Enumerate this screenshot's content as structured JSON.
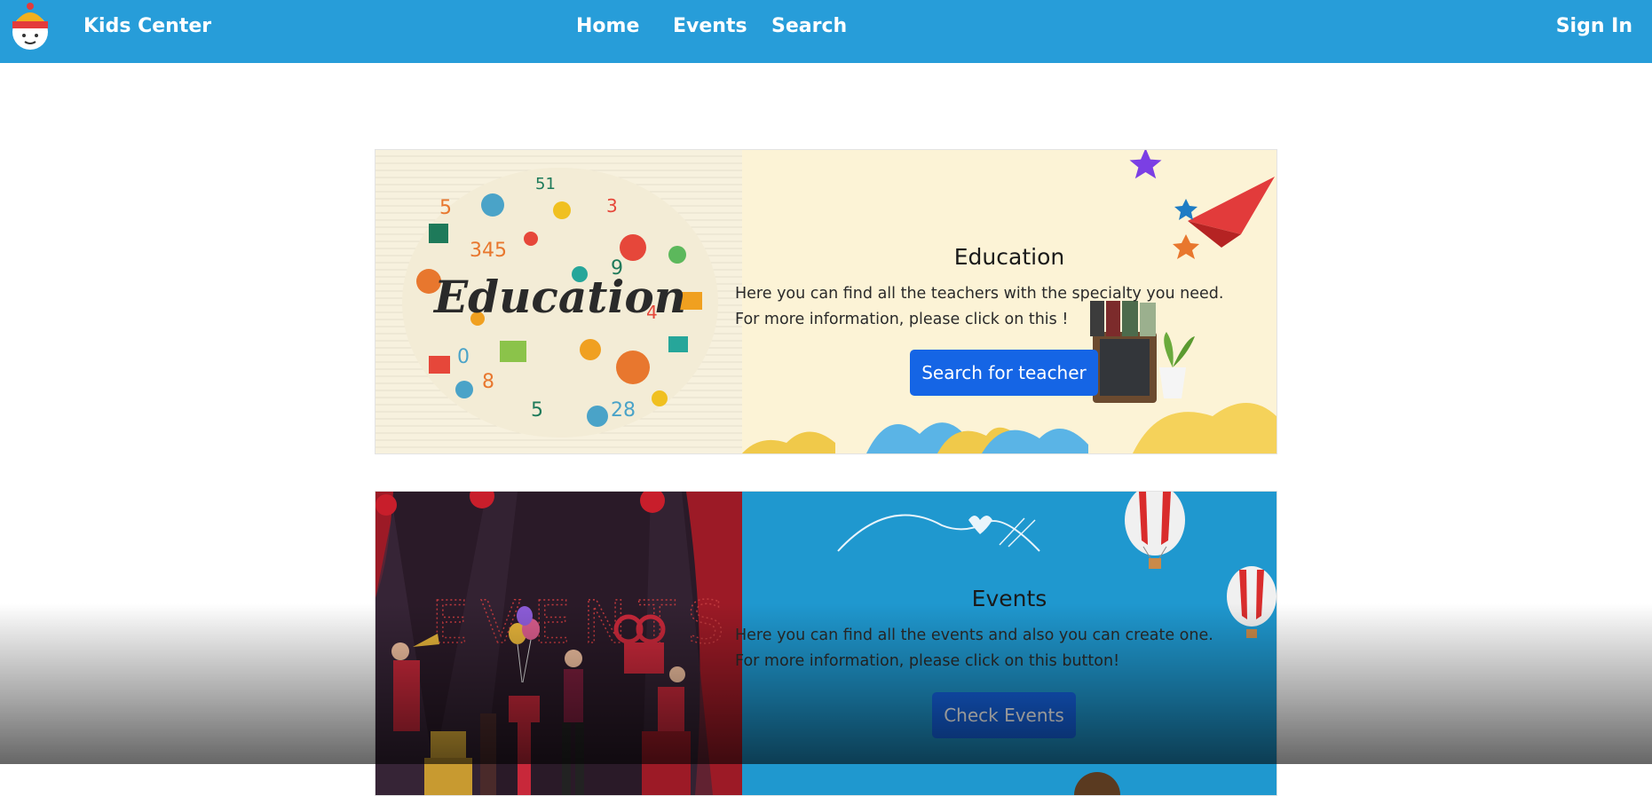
{
  "navbar": {
    "brand": "Kids Center",
    "links": [
      "Home",
      "Events",
      "Search"
    ],
    "sign_in": "Sign In",
    "color": "#279dd9"
  },
  "cards": {
    "education": {
      "image_text": "Education",
      "title": "Education",
      "text": "Here you can find all the teachers with the specialty you need. For more information, please click on this !",
      "button": "Search for teacher"
    },
    "events": {
      "image_text": "EVENTS",
      "title": "Events",
      "text": "Here you can find all the events and also you can create one. For more information, please click on this button!",
      "button": "Check Events"
    }
  },
  "colors": {
    "button": "#1565e5",
    "education_bg": "#fcf3d6",
    "events_bg": "#1f98cf"
  }
}
